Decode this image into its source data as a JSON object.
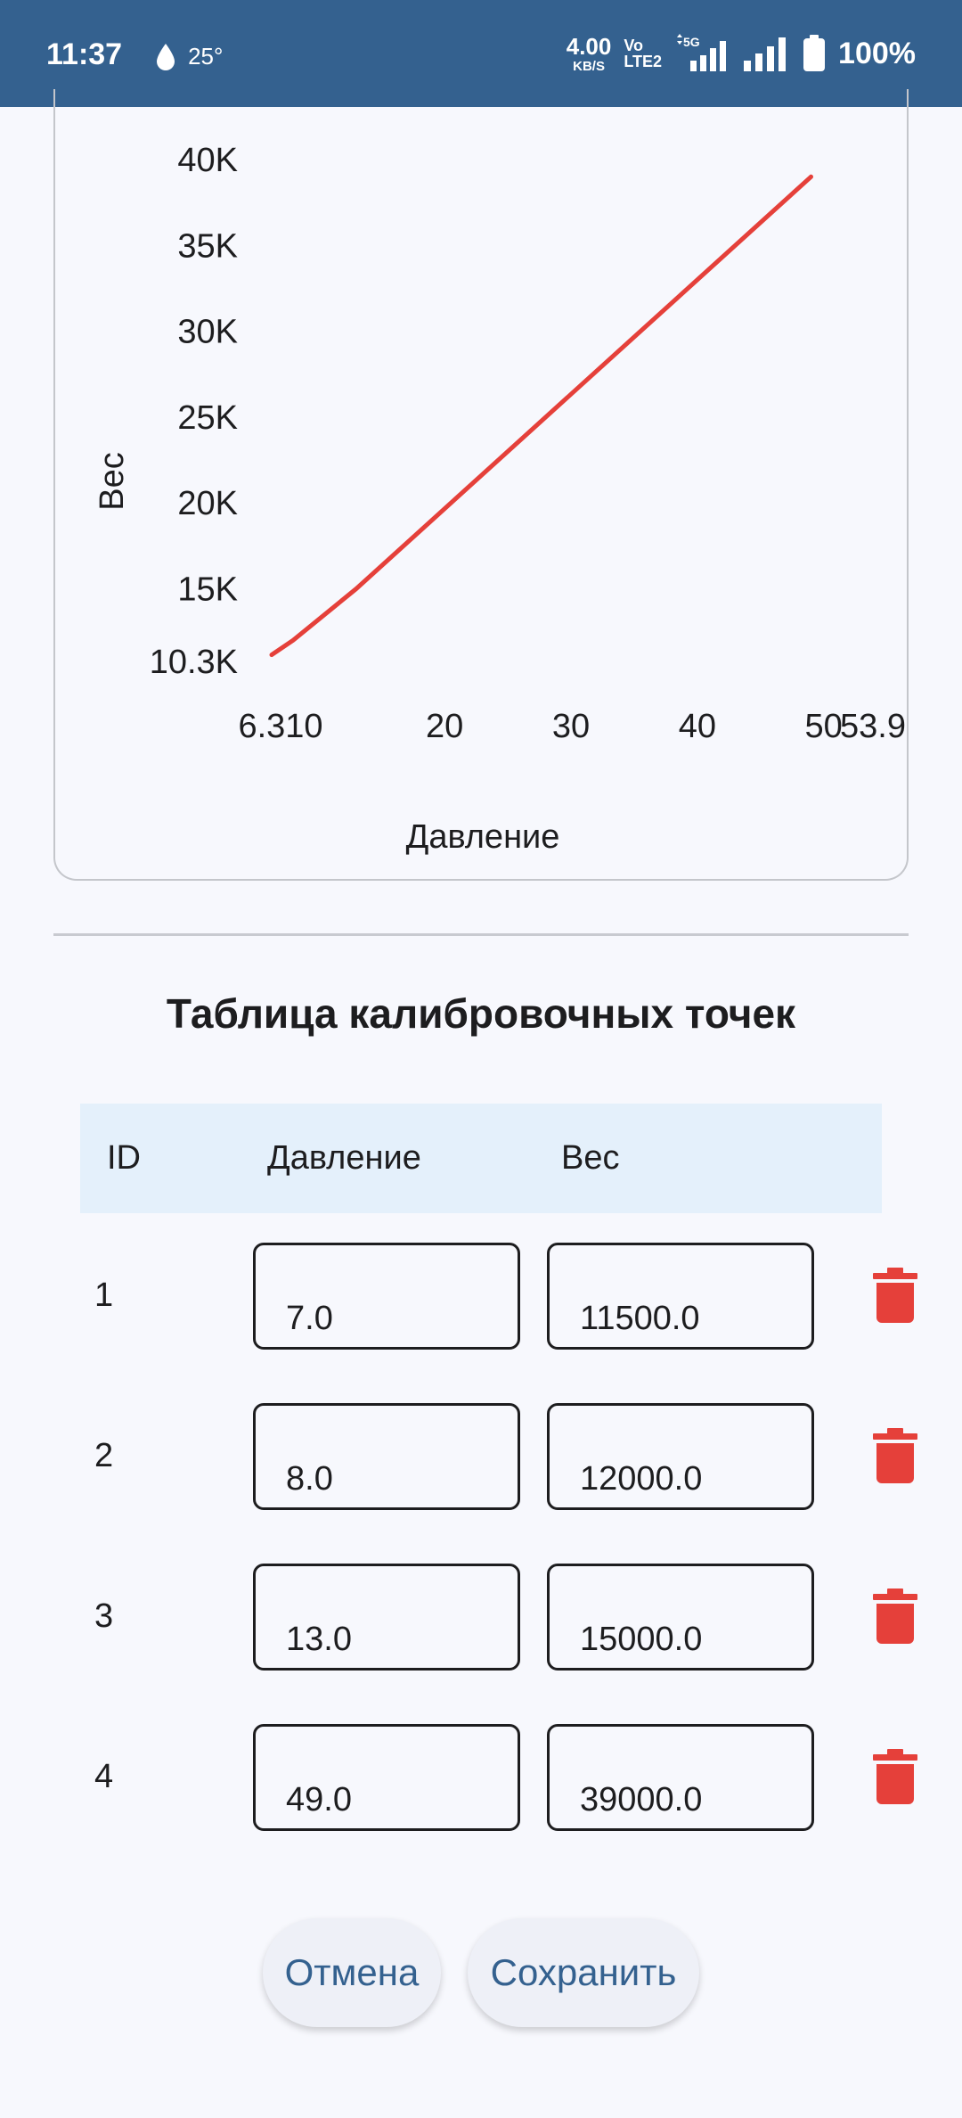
{
  "status_bar": {
    "time": "11:37",
    "temperature": "25°",
    "net_speed_value": "4.00",
    "net_speed_unit": "KB/S",
    "volte_top": "Vo",
    "volte_bottom": "LTE2",
    "network": "5G",
    "battery_percent": "100%",
    "icons": [
      "water-drop-icon",
      "signal-5g-icon",
      "signal-icon",
      "battery-icon"
    ]
  },
  "chart_data": {
    "type": "line",
    "xlabel": "Давление",
    "ylabel": "Вес",
    "xlim": [
      6.31,
      53.9
    ],
    "ylim": [
      10300,
      40000
    ],
    "x_ticks": [
      "6.310",
      "20",
      "30",
      "40",
      "50",
      "53.9"
    ],
    "y_ticks": [
      "40K",
      "35K",
      "30K",
      "25K",
      "20K",
      "15K",
      "10.3K"
    ],
    "y_tick_values": [
      40000,
      35000,
      30000,
      25000,
      20000,
      15000,
      10300
    ],
    "x_tick_values": [
      10,
      20,
      30,
      40,
      50,
      53.9
    ],
    "series": [
      {
        "color": "#e5403a",
        "x": [
          6.31,
          7.0,
          8.0,
          13.0,
          49.0
        ],
        "y": [
          11150,
          11500,
          12000,
          15000,
          39000
        ]
      }
    ],
    "grid": false
  },
  "table": {
    "title": "Таблица калибровочных точек",
    "headers": {
      "id": "ID",
      "pressure": "Давление",
      "weight": "Вес"
    },
    "rows": [
      {
        "id": "1",
        "pressure": "7.0",
        "weight": "11500.0"
      },
      {
        "id": "2",
        "pressure": "8.0",
        "weight": "12000.0"
      },
      {
        "id": "3",
        "pressure": "13.0",
        "weight": "15000.0"
      },
      {
        "id": "4",
        "pressure": "49.0",
        "weight": "39000.0"
      }
    ],
    "delete_icon": "trash-icon",
    "delete_color": "#e5403a"
  },
  "actions": {
    "cancel_label": "Отмена",
    "save_label": "Сохранить",
    "accent": "#34618f"
  }
}
